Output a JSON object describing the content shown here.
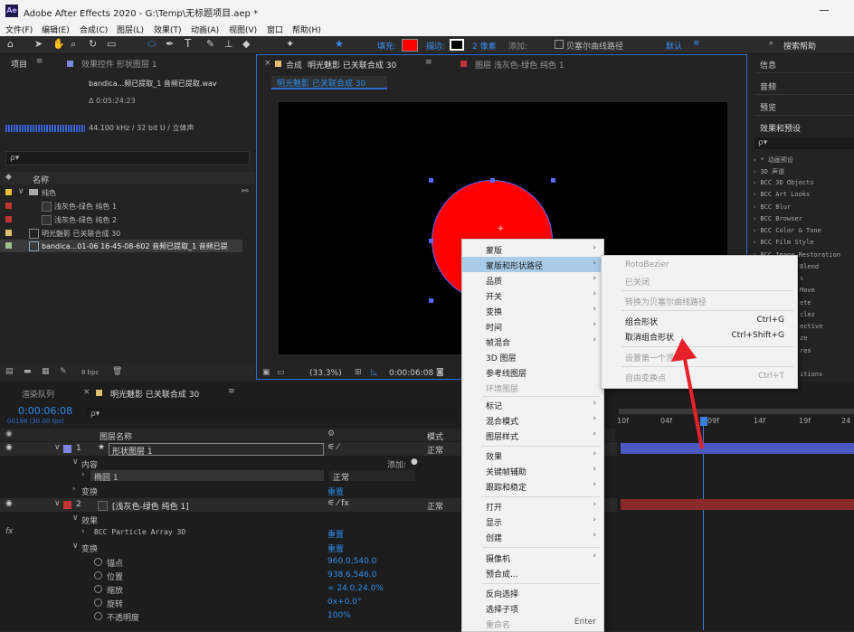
{
  "title_bar": {
    "app_icon": "Ae",
    "title": "Adobe After Effects 2020 - G:\\Temp\\无标题项目.aep *"
  },
  "menu": [
    "文件(F)",
    "编辑(E)",
    "合成(C)",
    "图层(L)",
    "效果(T)",
    "动画(A)",
    "视图(V)",
    "窗口",
    "帮助(H)"
  ],
  "toolbar": {
    "fill_label": "填充:",
    "stroke_label": "描边:",
    "stroke_px": "2 像素",
    "add_label": "添加:",
    "bezier_label": "贝塞尔曲线路径",
    "workspace": "默认",
    "search_placeholder": "搜索帮助",
    "fill_color": "#ff0000"
  },
  "project_panel": {
    "tab_project": "项目",
    "tab_effects": "效果控件 形状图层 1",
    "file_name": "bandica...频已提取_1 音频已提取.wav",
    "duration": "Δ 0:05:24:23",
    "audio_info": "44.100 kHz / 32 bit U / 立体声",
    "search_placeholder": "ρ▾",
    "col_name": "名称",
    "items": [
      {
        "name": "纯色",
        "color": "#e8c23a"
      },
      {
        "name": "浅灰色-绿色 纯色 1",
        "color": "#c23333"
      },
      {
        "name": "浅灰色-绿色 纯色 2",
        "color": "#c23333"
      },
      {
        "name": "明光魅影 已关联合成 30",
        "color": "#e0c070"
      },
      {
        "name": "bandica...01-06 16-45-08-602 音频已提取_1 音频已提",
        "color": "#a0c090"
      }
    ],
    "bpc": "8 bpc"
  },
  "comp_panel": {
    "tab_comp_prefix": "合成",
    "tab_comp": "明光魅影 已关联合成 30",
    "tab_layer": "图层 浅灰色-绿色 纯色 1",
    "breadcrumb": "明光魅影 已关联合成 30",
    "zoom": "(33.3%)",
    "timecode": "0:00:06:08",
    "circle_color": "#ff0000"
  },
  "right_panel": {
    "tabs": [
      "信息",
      "音频",
      "预览",
      "效果和预设"
    ],
    "search_placeholder": "ρ▾",
    "presets": [
      "› * 动画预设",
      "› 3D 声道",
      "› BCC 3D Objects",
      "› BCC Art Looks",
      "› BCC Blur",
      "› BCC Browser",
      "› BCC Color & Tone",
      "› BCC Film Style",
      "› BCC Image Restoration",
      "Blend",
      "s",
      "Move",
      "ete",
      "clez",
      "ective",
      "ze",
      "res",
      "itions"
    ]
  },
  "timeline": {
    "tab_render": "渲染队列",
    "tab_comp": "明光魅影 已关联合成 30",
    "timecode": "0:00:06:08",
    "frame_info": "00188 (30.00 fps)",
    "search_placeholder": "ρ▾",
    "col_layer_name": "图层名称",
    "col_mode": "模式",
    "add_label": "添加:",
    "layer1": {
      "num": "1",
      "name": "形状图层 1",
      "mode": "正常",
      "color": "#7b86e0"
    },
    "content": "内容",
    "ellipse": "椭圆 1",
    "ellipse_mode": "正常",
    "transform": "变换",
    "reset": "重置",
    "layer2": {
      "num": "2",
      "name": "[浅灰色-绿色 纯色 1]",
      "mode": "正常",
      "color": "#c23333"
    },
    "effects": "效果",
    "bcc": "BCC Particle Array 3D",
    "props": [
      {
        "label": "锚点",
        "value": "960.0,540.0"
      },
      {
        "label": "位置",
        "value": "938.6,546.0"
      },
      {
        "label": "缩放",
        "value": "∞ 24.0,24.0%"
      },
      {
        "label": "旋转",
        "value": "0x+0.0°"
      },
      {
        "label": "不透明度",
        "value": "100%"
      }
    ],
    "ruler": [
      "10f",
      "04f",
      "09f",
      "14f",
      "19f",
      "24"
    ]
  },
  "context_menu": {
    "items": [
      {
        "label": "蒙版",
        "arrow": "›"
      },
      {
        "label": "蒙版和形状路径",
        "arrow": "›",
        "highlight": true
      },
      {
        "label": "品质",
        "arrow": "›"
      },
      {
        "label": "开关",
        "arrow": "›"
      },
      {
        "label": "变换",
        "arrow": "›"
      },
      {
        "label": "时间",
        "arrow": "›"
      },
      {
        "label": "帧混合",
        "arrow": "›"
      },
      {
        "label": "3D 图层"
      },
      {
        "label": "参考线图层"
      },
      {
        "label": "环境图层",
        "disabled": true
      },
      {
        "label": "标记",
        "arrow": "›"
      },
      {
        "label": "混合模式",
        "arrow": "›"
      },
      {
        "label": "图层样式",
        "arrow": "›"
      },
      {
        "label": "效果",
        "arrow": "›"
      },
      {
        "label": "关键帧辅助",
        "arrow": "›"
      },
      {
        "label": "跟踪和稳定",
        "arrow": "›"
      },
      {
        "label": "打开",
        "arrow": "›"
      },
      {
        "label": "显示",
        "arrow": "›"
      },
      {
        "label": "创建",
        "arrow": "›"
      },
      {
        "label": "摄像机",
        "arrow": "›"
      },
      {
        "label": "预合成..."
      },
      {
        "label": "反向选择"
      },
      {
        "label": "选择子项"
      },
      {
        "label": "重命名",
        "arrow": "Enter",
        "disabled": true
      }
    ]
  },
  "submenu": {
    "items": [
      {
        "label": "RotoBezier",
        "disabled": true
      },
      {
        "label": "已关闭",
        "disabled": true
      },
      {
        "label": "转换为贝塞尔曲线路径",
        "disabled": true
      },
      {
        "label": "组合形状",
        "key": "Ctrl+G"
      },
      {
        "label": "取消组合形状",
        "key": "Ctrl+Shift+G"
      },
      {
        "label": "设置第一个顶点",
        "disabled": true
      },
      {
        "label": "自由变换点",
        "key": "Ctrl+T",
        "disabled": true
      }
    ]
  }
}
